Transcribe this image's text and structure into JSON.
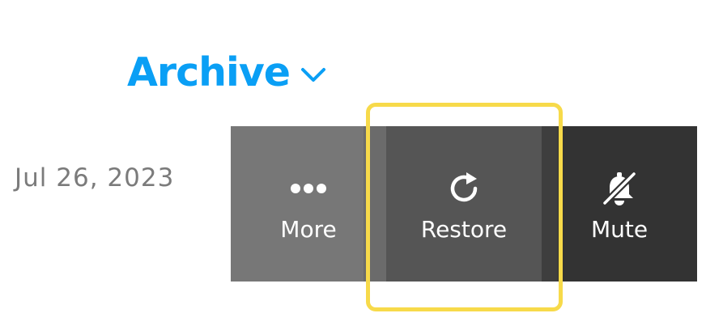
{
  "header": {
    "title": "Archive",
    "chevron_icon": "chevron-down-icon"
  },
  "row": {
    "date": "Jul 26, 2023"
  },
  "actions": [
    {
      "label": "More",
      "icon": "more-dots-icon",
      "color": "#777777"
    },
    {
      "label": "Restore",
      "icon": "restore-icon",
      "color": "#555555"
    },
    {
      "label": "Mute",
      "icon": "bell-slash-icon",
      "color": "#333333"
    }
  ],
  "colors": {
    "accent": "#0a9ff5",
    "highlight": "#f7da4a",
    "date_text": "#7b7b7b"
  }
}
